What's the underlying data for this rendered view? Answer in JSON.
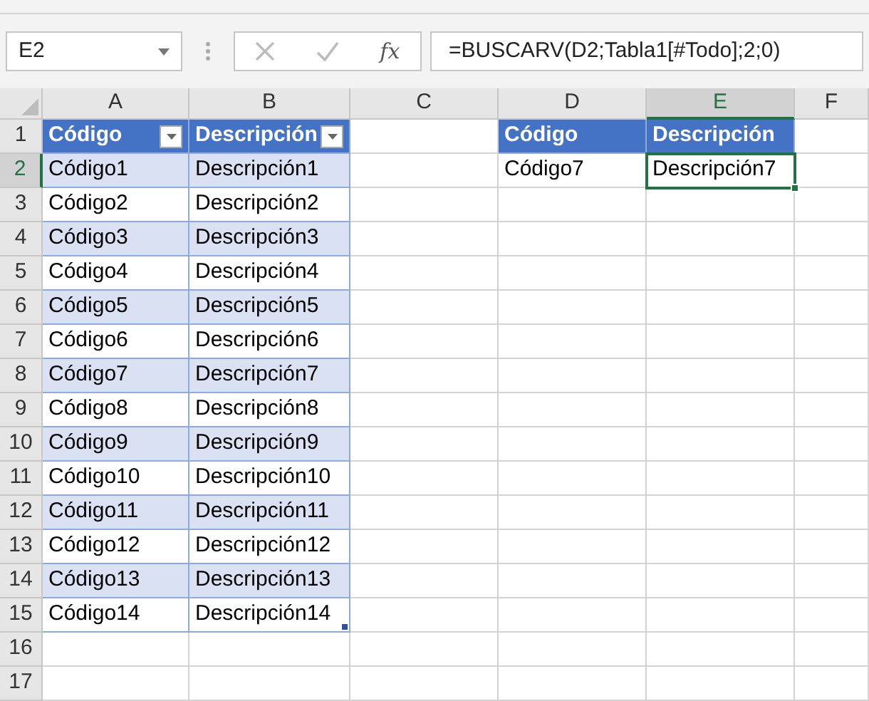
{
  "name_box": {
    "value": "E2"
  },
  "formula_bar": {
    "function_button": "fx",
    "formula": "=BUSCARV(D2;Tabla1[#Todo];2;0)"
  },
  "columns": [
    {
      "label": "A",
      "selected": false
    },
    {
      "label": "B",
      "selected": false
    },
    {
      "label": "C",
      "selected": false
    },
    {
      "label": "D",
      "selected": false
    },
    {
      "label": "E",
      "selected": true
    },
    {
      "label": "F",
      "selected": false
    }
  ],
  "rows": [
    {
      "label": "1",
      "selected": false,
      "cells": [
        {
          "kind": "header",
          "text": "Código",
          "filter": true,
          "selected": false
        },
        {
          "kind": "header",
          "text": "Descripción",
          "filter": true,
          "selected": false
        },
        {
          "kind": "empty",
          "selected": false
        },
        {
          "kind": "header",
          "text": "Código",
          "filter": false,
          "selected": false
        },
        {
          "kind": "header",
          "text": "Descripción",
          "filter": false,
          "selected": false
        },
        {
          "kind": "empty",
          "selected": false
        }
      ]
    },
    {
      "label": "2",
      "selected": true,
      "cells": [
        {
          "kind": "band",
          "text": "Código1",
          "selected": false
        },
        {
          "kind": "band",
          "text": "Descripción1",
          "selected": false
        },
        {
          "kind": "empty",
          "selected": false
        },
        {
          "kind": "plain",
          "text": "Código7",
          "selected": false
        },
        {
          "kind": "plain",
          "text": "Descripción7",
          "selected": true
        },
        {
          "kind": "empty",
          "selected": false
        }
      ]
    },
    {
      "label": "3",
      "selected": false,
      "cells": [
        {
          "kind": "plain",
          "text": "Código2",
          "selected": false
        },
        {
          "kind": "plain",
          "text": "Descripción2",
          "selected": false
        },
        {
          "kind": "empty",
          "selected": false
        },
        {
          "kind": "empty",
          "selected": false
        },
        {
          "kind": "empty",
          "selected": false
        },
        {
          "kind": "empty",
          "selected": false
        }
      ]
    },
    {
      "label": "4",
      "selected": false,
      "cells": [
        {
          "kind": "band",
          "text": "Código3",
          "selected": false
        },
        {
          "kind": "band",
          "text": "Descripción3",
          "selected": false
        },
        {
          "kind": "empty",
          "selected": false
        },
        {
          "kind": "empty",
          "selected": false
        },
        {
          "kind": "empty",
          "selected": false
        },
        {
          "kind": "empty",
          "selected": false
        }
      ]
    },
    {
      "label": "5",
      "selected": false,
      "cells": [
        {
          "kind": "plain",
          "text": "Código4",
          "selected": false
        },
        {
          "kind": "plain",
          "text": "Descripción4",
          "selected": false
        },
        {
          "kind": "empty",
          "selected": false
        },
        {
          "kind": "empty",
          "selected": false
        },
        {
          "kind": "empty",
          "selected": false
        },
        {
          "kind": "empty",
          "selected": false
        }
      ]
    },
    {
      "label": "6",
      "selected": false,
      "cells": [
        {
          "kind": "band",
          "text": "Código5",
          "selected": false
        },
        {
          "kind": "band",
          "text": "Descripción5",
          "selected": false
        },
        {
          "kind": "empty",
          "selected": false
        },
        {
          "kind": "empty",
          "selected": false
        },
        {
          "kind": "empty",
          "selected": false
        },
        {
          "kind": "empty",
          "selected": false
        }
      ]
    },
    {
      "label": "7",
      "selected": false,
      "cells": [
        {
          "kind": "plain",
          "text": "Código6",
          "selected": false
        },
        {
          "kind": "plain",
          "text": "Descripción6",
          "selected": false
        },
        {
          "kind": "empty",
          "selected": false
        },
        {
          "kind": "empty",
          "selected": false
        },
        {
          "kind": "empty",
          "selected": false
        },
        {
          "kind": "empty",
          "selected": false
        }
      ]
    },
    {
      "label": "8",
      "selected": false,
      "cells": [
        {
          "kind": "band",
          "text": "Código7",
          "selected": false
        },
        {
          "kind": "band",
          "text": "Descripción7",
          "selected": false
        },
        {
          "kind": "empty",
          "selected": false
        },
        {
          "kind": "empty",
          "selected": false
        },
        {
          "kind": "empty",
          "selected": false
        },
        {
          "kind": "empty",
          "selected": false
        }
      ]
    },
    {
      "label": "9",
      "selected": false,
      "cells": [
        {
          "kind": "plain",
          "text": "Código8",
          "selected": false
        },
        {
          "kind": "plain",
          "text": "Descripción8",
          "selected": false
        },
        {
          "kind": "empty",
          "selected": false
        },
        {
          "kind": "empty",
          "selected": false
        },
        {
          "kind": "empty",
          "selected": false
        },
        {
          "kind": "empty",
          "selected": false
        }
      ]
    },
    {
      "label": "10",
      "selected": false,
      "cells": [
        {
          "kind": "band",
          "text": "Código9",
          "selected": false
        },
        {
          "kind": "band",
          "text": "Descripción9",
          "selected": false
        },
        {
          "kind": "empty",
          "selected": false
        },
        {
          "kind": "empty",
          "selected": false
        },
        {
          "kind": "empty",
          "selected": false
        },
        {
          "kind": "empty",
          "selected": false
        }
      ]
    },
    {
      "label": "11",
      "selected": false,
      "cells": [
        {
          "kind": "plain",
          "text": "Código10",
          "selected": false
        },
        {
          "kind": "plain",
          "text": "Descripción10",
          "selected": false
        },
        {
          "kind": "empty",
          "selected": false
        },
        {
          "kind": "empty",
          "selected": false
        },
        {
          "kind": "empty",
          "selected": false
        },
        {
          "kind": "empty",
          "selected": false
        }
      ]
    },
    {
      "label": "12",
      "selected": false,
      "cells": [
        {
          "kind": "band",
          "text": "Código11",
          "selected": false
        },
        {
          "kind": "band",
          "text": "Descripción11",
          "selected": false
        },
        {
          "kind": "empty",
          "selected": false
        },
        {
          "kind": "empty",
          "selected": false
        },
        {
          "kind": "empty",
          "selected": false
        },
        {
          "kind": "empty",
          "selected": false
        }
      ]
    },
    {
      "label": "13",
      "selected": false,
      "cells": [
        {
          "kind": "plain",
          "text": "Código12",
          "selected": false
        },
        {
          "kind": "plain",
          "text": "Descripción12",
          "selected": false
        },
        {
          "kind": "empty",
          "selected": false
        },
        {
          "kind": "empty",
          "selected": false
        },
        {
          "kind": "empty",
          "selected": false
        },
        {
          "kind": "empty",
          "selected": false
        }
      ]
    },
    {
      "label": "14",
      "selected": false,
      "cells": [
        {
          "kind": "band",
          "text": "Código13",
          "selected": false
        },
        {
          "kind": "band",
          "text": "Descripción13",
          "selected": false
        },
        {
          "kind": "empty",
          "selected": false
        },
        {
          "kind": "empty",
          "selected": false
        },
        {
          "kind": "empty",
          "selected": false
        },
        {
          "kind": "empty",
          "selected": false
        }
      ]
    },
    {
      "label": "15",
      "selected": false,
      "cells": [
        {
          "kind": "plain",
          "text": "Código14",
          "selected": false
        },
        {
          "kind": "plain",
          "text": "Descripción14",
          "resize_handle": true,
          "selected": false
        },
        {
          "kind": "empty",
          "selected": false
        },
        {
          "kind": "empty",
          "selected": false
        },
        {
          "kind": "empty",
          "selected": false
        },
        {
          "kind": "empty",
          "selected": false
        }
      ]
    },
    {
      "label": "16",
      "selected": false,
      "cells": [
        {
          "kind": "empty",
          "selected": false
        },
        {
          "kind": "empty",
          "selected": false
        },
        {
          "kind": "empty",
          "selected": false
        },
        {
          "kind": "empty",
          "selected": false
        },
        {
          "kind": "empty",
          "selected": false
        },
        {
          "kind": "empty",
          "selected": false
        }
      ]
    },
    {
      "label": "17",
      "selected": false,
      "cells": [
        {
          "kind": "empty",
          "selected": false
        },
        {
          "kind": "empty",
          "selected": false
        },
        {
          "kind": "empty",
          "selected": false
        },
        {
          "kind": "empty",
          "selected": false
        },
        {
          "kind": "empty",
          "selected": false
        },
        {
          "kind": "empty",
          "selected": false
        }
      ]
    }
  ]
}
